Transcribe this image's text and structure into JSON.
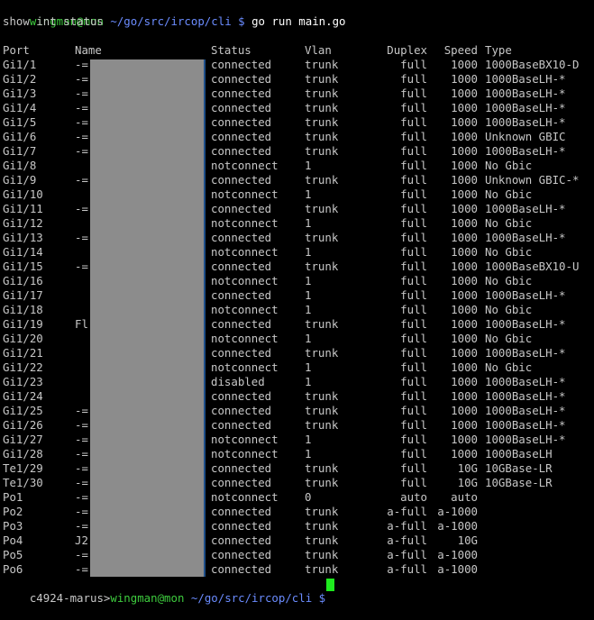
{
  "terminal": {
    "prompt_user": "wingman@mon",
    "prompt_path": "~/go/src/ircop/cli",
    "prompt_symbol": "$",
    "command": "go run main.go",
    "output_first_line": "show int status",
    "headers": {
      "port": "Port",
      "name": "Name",
      "status": "Status",
      "vlan": "Vlan",
      "duplex": "Duplex",
      "speed": "Speed",
      "type": "Type"
    },
    "rows": [
      {
        "port": "Gi1/1",
        "name": "-=",
        "status": "connected",
        "vlan": "trunk",
        "duplex": "full",
        "speed": "1000",
        "type": "1000BaseBX10-D"
      },
      {
        "port": "Gi1/2",
        "name": "-=",
        "status": "connected",
        "vlan": "trunk",
        "duplex": "full",
        "speed": "1000",
        "type": "1000BaseLH-*"
      },
      {
        "port": "Gi1/3",
        "name": "-=",
        "status": "connected",
        "vlan": "trunk",
        "duplex": "full",
        "speed": "1000",
        "type": "1000BaseLH-*"
      },
      {
        "port": "Gi1/4",
        "name": "-=",
        "status": "connected",
        "vlan": "trunk",
        "duplex": "full",
        "speed": "1000",
        "type": "1000BaseLH-*"
      },
      {
        "port": "Gi1/5",
        "name": "-=",
        "status": "connected",
        "vlan": "trunk",
        "duplex": "full",
        "speed": "1000",
        "type": "1000BaseLH-*"
      },
      {
        "port": "Gi1/6",
        "name": "-=",
        "status": "connected",
        "vlan": "trunk",
        "duplex": "full",
        "speed": "1000",
        "type": "Unknown GBIC"
      },
      {
        "port": "Gi1/7",
        "name": "-=",
        "status": "connected",
        "vlan": "trunk",
        "duplex": "full",
        "speed": "1000",
        "type": "1000BaseLH-*"
      },
      {
        "port": "Gi1/8",
        "name": "",
        "status": "notconnect",
        "vlan": "1",
        "duplex": "full",
        "speed": "1000",
        "type": "No Gbic"
      },
      {
        "port": "Gi1/9",
        "name": "-=",
        "status": "connected",
        "vlan": "trunk",
        "duplex": "full",
        "speed": "1000",
        "type": "Unknown GBIC-*"
      },
      {
        "port": "Gi1/10",
        "name": "",
        "status": "notconnect",
        "vlan": "1",
        "duplex": "full",
        "speed": "1000",
        "type": "No Gbic"
      },
      {
        "port": "Gi1/11",
        "name": "-=",
        "status": "connected",
        "vlan": "trunk",
        "duplex": "full",
        "speed": "1000",
        "type": "1000BaseLH-*"
      },
      {
        "port": "Gi1/12",
        "name": "",
        "status": "notconnect",
        "vlan": "1",
        "duplex": "full",
        "speed": "1000",
        "type": "No Gbic"
      },
      {
        "port": "Gi1/13",
        "name": "-=",
        "status": "connected",
        "vlan": "trunk",
        "duplex": "full",
        "speed": "1000",
        "type": "1000BaseLH-*"
      },
      {
        "port": "Gi1/14",
        "name": "",
        "status": "notconnect",
        "vlan": "1",
        "duplex": "full",
        "speed": "1000",
        "type": "No Gbic"
      },
      {
        "port": "Gi1/15",
        "name": "-=",
        "status": "connected",
        "vlan": "trunk",
        "duplex": "full",
        "speed": "1000",
        "type": "1000BaseBX10-U"
      },
      {
        "port": "Gi1/16",
        "name": "",
        "status": "notconnect",
        "vlan": "1",
        "duplex": "full",
        "speed": "1000",
        "type": "No Gbic"
      },
      {
        "port": "Gi1/17",
        "name": "",
        "status": "connected",
        "vlan": "1",
        "duplex": "full",
        "speed": "1000",
        "type": "1000BaseLH-*"
      },
      {
        "port": "Gi1/18",
        "name": "",
        "status": "notconnect",
        "vlan": "1",
        "duplex": "full",
        "speed": "1000",
        "type": "No Gbic"
      },
      {
        "port": "Gi1/19",
        "name": "Fl",
        "status": "connected",
        "vlan": "trunk",
        "duplex": "full",
        "speed": "1000",
        "type": "1000BaseLH-*"
      },
      {
        "port": "Gi1/20",
        "name": "",
        "status": "notconnect",
        "vlan": "1",
        "duplex": "full",
        "speed": "1000",
        "type": "No Gbic"
      },
      {
        "port": "Gi1/21",
        "name": "",
        "status": "connected",
        "vlan": "trunk",
        "duplex": "full",
        "speed": "1000",
        "type": "1000BaseLH-*"
      },
      {
        "port": "Gi1/22",
        "name": "",
        "status": "notconnect",
        "vlan": "1",
        "duplex": "full",
        "speed": "1000",
        "type": "No Gbic"
      },
      {
        "port": "Gi1/23",
        "name": "",
        "status": "disabled",
        "vlan": "1",
        "duplex": "full",
        "speed": "1000",
        "type": "1000BaseLH-*"
      },
      {
        "port": "Gi1/24",
        "name": "",
        "status": "connected",
        "vlan": "trunk",
        "duplex": "full",
        "speed": "1000",
        "type": "1000BaseLH-*"
      },
      {
        "port": "Gi1/25",
        "name": "-=",
        "status": "connected",
        "vlan": "trunk",
        "duplex": "full",
        "speed": "1000",
        "type": "1000BaseLH-*"
      },
      {
        "port": "Gi1/26",
        "name": "-=",
        "status": "connected",
        "vlan": "trunk",
        "duplex": "full",
        "speed": "1000",
        "type": "1000BaseLH-*"
      },
      {
        "port": "Gi1/27",
        "name": "-=",
        "status": "notconnect",
        "vlan": "1",
        "duplex": "full",
        "speed": "1000",
        "type": "1000BaseLH-*"
      },
      {
        "port": "Gi1/28",
        "name": "-=",
        "status": "notconnect",
        "vlan": "1",
        "duplex": "full",
        "speed": "1000",
        "type": "1000BaseLH"
      },
      {
        "port": "Te1/29",
        "name": "-=",
        "status": "connected",
        "vlan": "trunk",
        "duplex": "full",
        "speed": "10G",
        "type": "10GBase-LR"
      },
      {
        "port": "Te1/30",
        "name": "-=",
        "status": "connected",
        "vlan": "trunk",
        "duplex": "full",
        "speed": "10G",
        "type": "10GBase-LR"
      },
      {
        "port": "Po1",
        "name": "-=",
        "status": "notconnect",
        "vlan": "0",
        "duplex": "auto",
        "speed": "auto",
        "type": ""
      },
      {
        "port": "Po2",
        "name": "-=",
        "status": "connected",
        "vlan": "trunk",
        "duplex": "a-full",
        "speed": "a-1000",
        "type": ""
      },
      {
        "port": "Po3",
        "name": "-=",
        "status": "connected",
        "vlan": "trunk",
        "duplex": "a-full",
        "speed": "a-1000",
        "type": ""
      },
      {
        "port": "Po4",
        "name": "J2",
        "status": "connected",
        "vlan": "trunk",
        "duplex": "a-full",
        "speed": "10G",
        "type": ""
      },
      {
        "port": "Po5",
        "name": "-=",
        "status": "connected",
        "vlan": "trunk",
        "duplex": "a-full",
        "speed": "a-1000",
        "type": ""
      },
      {
        "port": "Po6",
        "name": "-=",
        "status": "connected",
        "vlan": "trunk",
        "duplex": "a-full",
        "speed": "a-1000",
        "type": ""
      }
    ],
    "final_prompt_host": "c4924-marus>",
    "final_prompt_user": "wingman@mon",
    "final_prompt_path": "~/go/src/ircop/cli",
    "final_prompt_symbol": "$"
  },
  "colors": {
    "background": "#000000",
    "text": "#c7c7c7",
    "prompt_green": "#3ecc3e",
    "path_blue": "#6b8cff",
    "redaction_gray": "#8c8c8c",
    "cursor_green": "#1eea1e"
  }
}
